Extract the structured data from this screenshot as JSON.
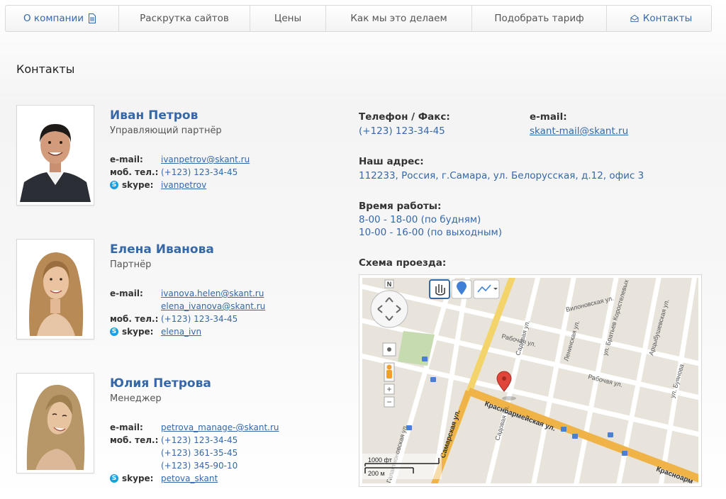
{
  "nav": {
    "items": [
      {
        "label": "О компании"
      },
      {
        "label": "Раскрутка сайтов"
      },
      {
        "label": "Цены"
      },
      {
        "label": "Как мы это делаем"
      },
      {
        "label": "Подобрать тариф"
      },
      {
        "label": "Контакты"
      }
    ]
  },
  "page_title": "Контакты",
  "people": [
    {
      "name": "Иван Петров",
      "role": "Управляющий партнёр",
      "email_label": "e-mail:",
      "emails": [
        "ivanpetrov@skant.ru"
      ],
      "phone_label": "моб. тел.:",
      "phones": [
        "(+123) 123-34-45"
      ],
      "skype_label": "skype:",
      "skype": "ivanpetrov"
    },
    {
      "name": "Елена Иванова",
      "role": "Партнёр",
      "email_label": "e-mail:",
      "emails": [
        "ivanova.helen@skant.ru",
        "elena_ivanova@skant.ru"
      ],
      "phone_label": "моб. тел.:",
      "phones": [
        "(+123) 123-34-45"
      ],
      "skype_label": "skype:",
      "skype": "elena_ivn"
    },
    {
      "name": "Юлия Петрова",
      "role": "Менеджер",
      "email_label": "e-mail:",
      "emails": [
        "petrova_manage-@skant.ru"
      ],
      "phone_label": "моб. тел.:",
      "phones": [
        "(+123) 123-34-45",
        "(+123) 361-35-45",
        "(+123) 345-90-10"
      ],
      "skype_label": "skype:",
      "skype": "petova_skant"
    }
  ],
  "contacts": {
    "phone_label": "Телефон / Факс:",
    "phone": "(+123) 123-34-45",
    "email_label": "e-mail:",
    "email": "skant-mail@skant.ru",
    "address_label": "Наш адрес:",
    "address": "112233, Россия, г.Самара, ул. Белорусская, д.12, офис 3",
    "hours_label": "Время работы:",
    "hours": [
      "8-00 - 18-00 (по будням)",
      "10-00 - 16-00 (по выходным)"
    ],
    "map_label": "Схема проезда:"
  },
  "map": {
    "streets": [
      "Самарская ул.",
      "Красноармейская ул.",
      "Рабочая ул.",
      "Садовая ул.",
      "Ленинская ул.",
      "Вилоновская ул.",
      "ул. Братьев Коростелевых",
      "Арцыбушевская ул.",
      "ул. Буянова",
      "Галактионовская ул.",
      "Красноарм"
    ],
    "compass": "N",
    "scale_ft": "1000 фт",
    "scale_m": "200 м",
    "zoom_in": "+",
    "zoom_out": "−"
  }
}
